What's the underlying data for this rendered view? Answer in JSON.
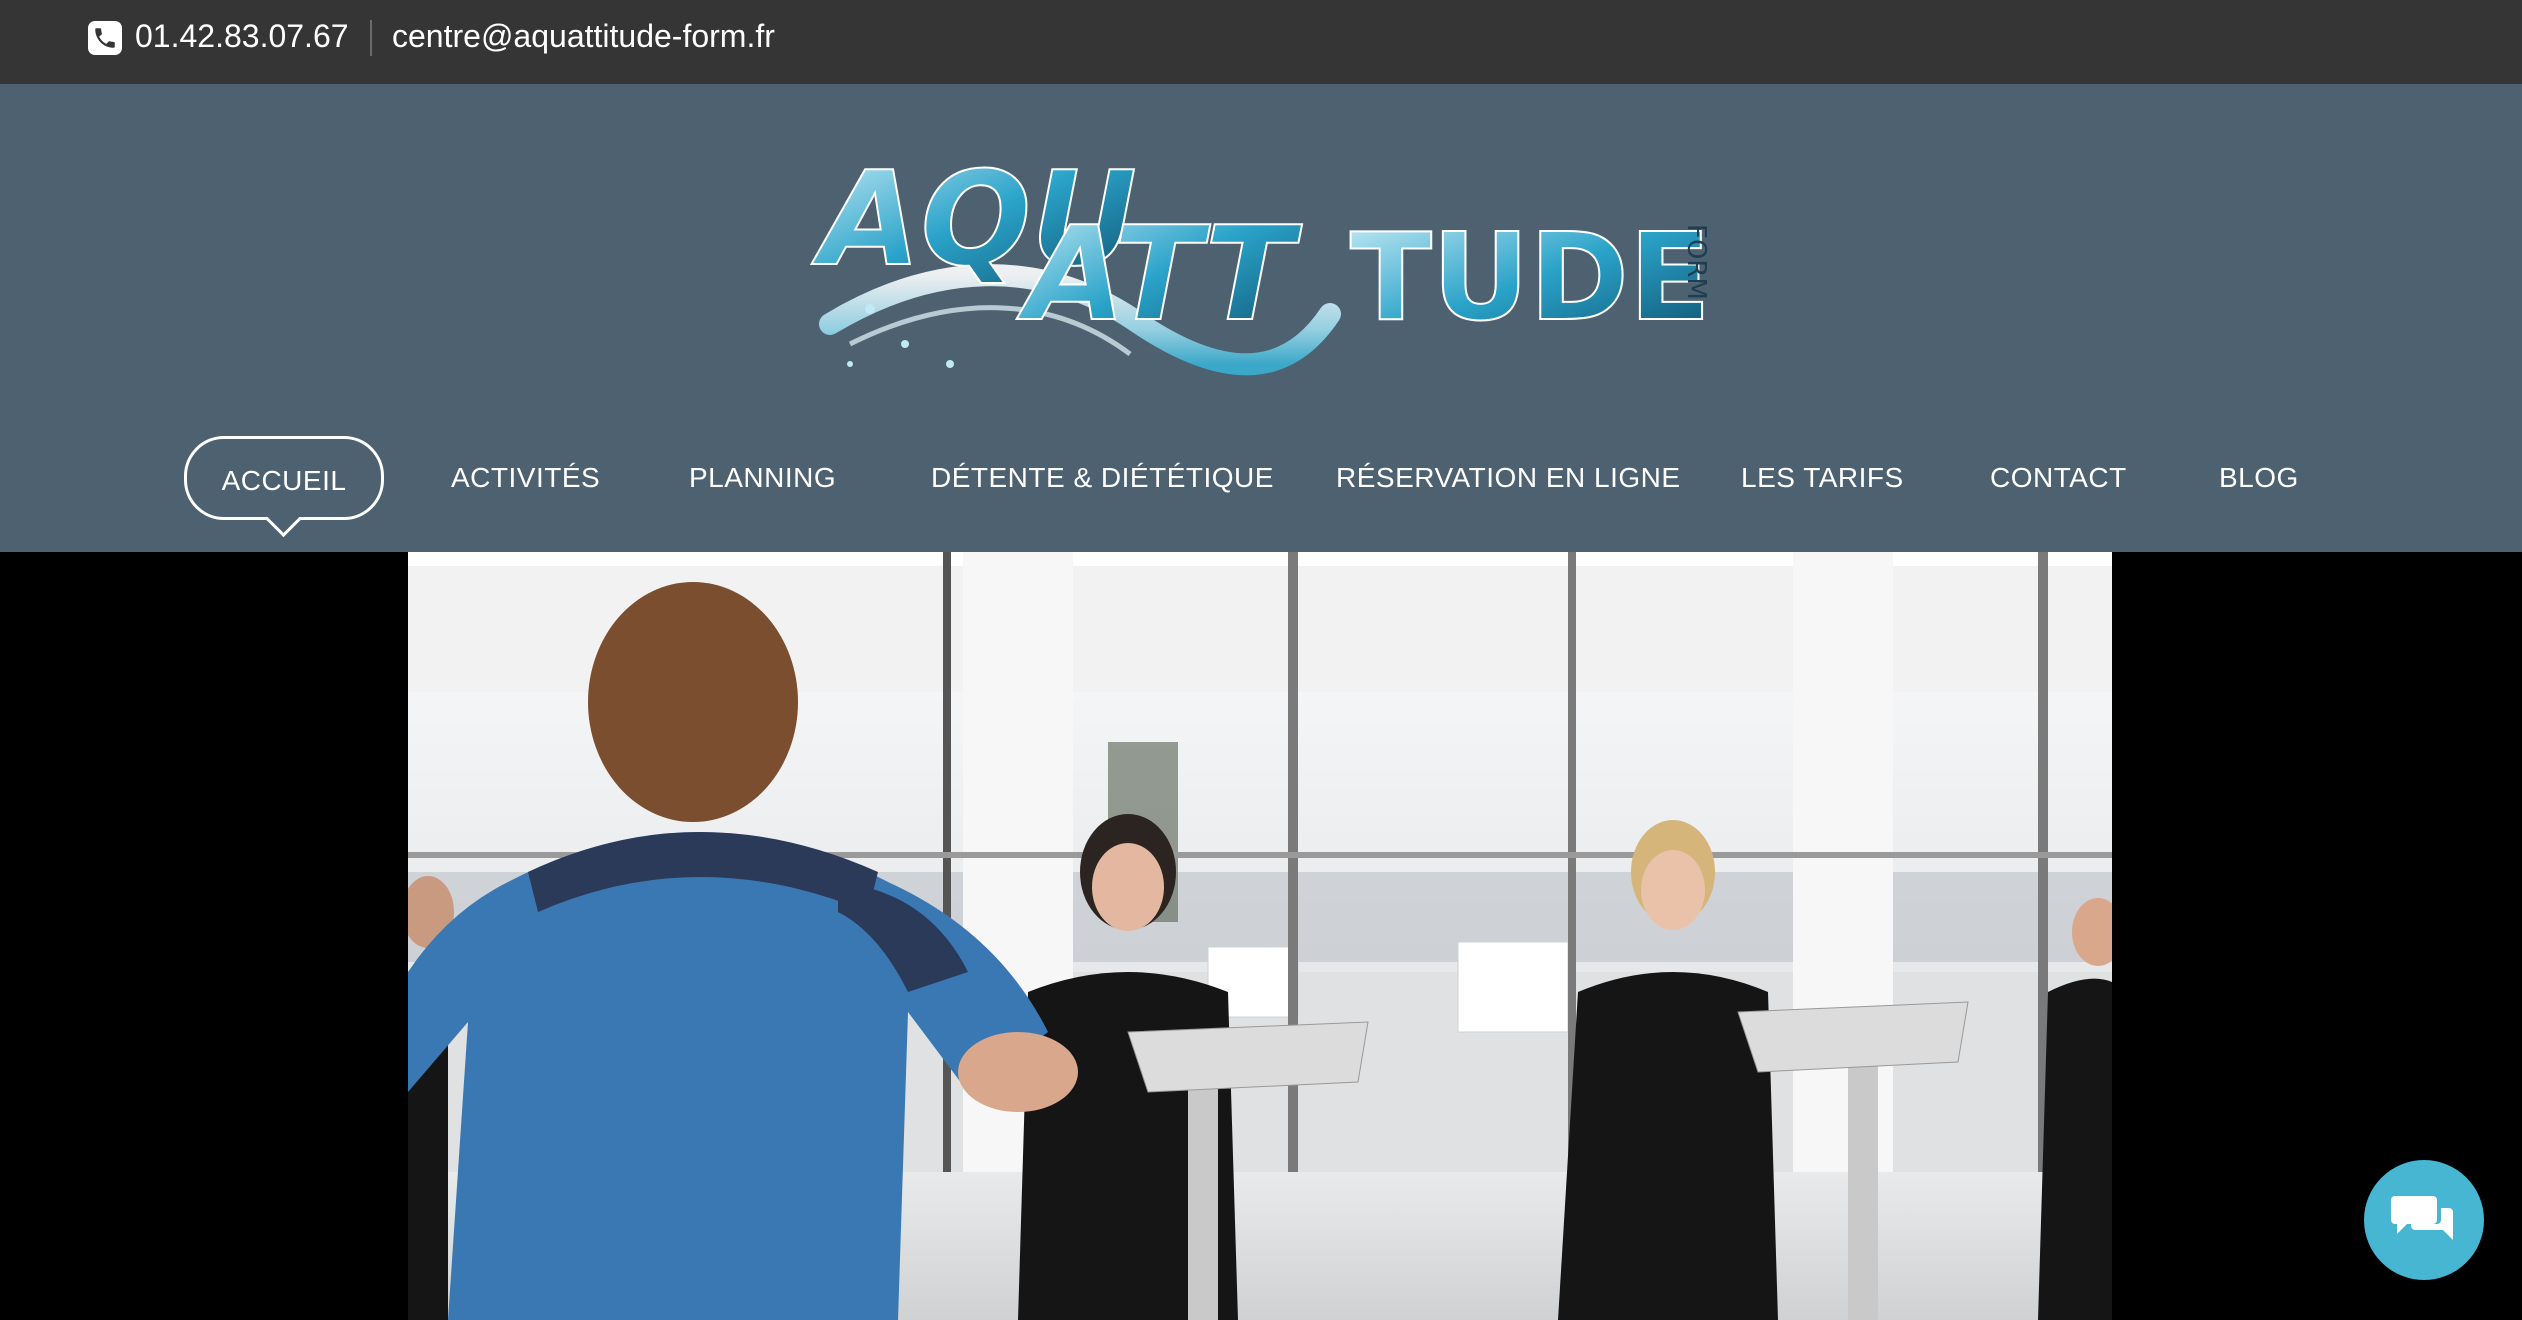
{
  "contact": {
    "phone": "01.42.83.07.67",
    "email": "centre@aquattitude-form.fr",
    "phone_icon": "phone-icon"
  },
  "logo": {
    "part1": "AQU",
    "part2": "ATT",
    "part3": "TUDE",
    "side": "FORM"
  },
  "nav": {
    "items": [
      {
        "label": "ACCUEIL",
        "active": true
      },
      {
        "label": "ACTIVITÉS"
      },
      {
        "label": "PLANNING"
      },
      {
        "label": "DÉTENTE & DIÉTÉTIQUE"
      },
      {
        "label": "RÉSERVATION EN LIGNE"
      },
      {
        "label": "LES TARIFS"
      },
      {
        "label": "CONTACT"
      },
      {
        "label": "BLOG"
      }
    ]
  },
  "colors": {
    "topbar": "#353535",
    "header": "#4d6170",
    "chat": "#46b6d3"
  },
  "chat": {
    "icon": "chat-bubbles-icon"
  }
}
